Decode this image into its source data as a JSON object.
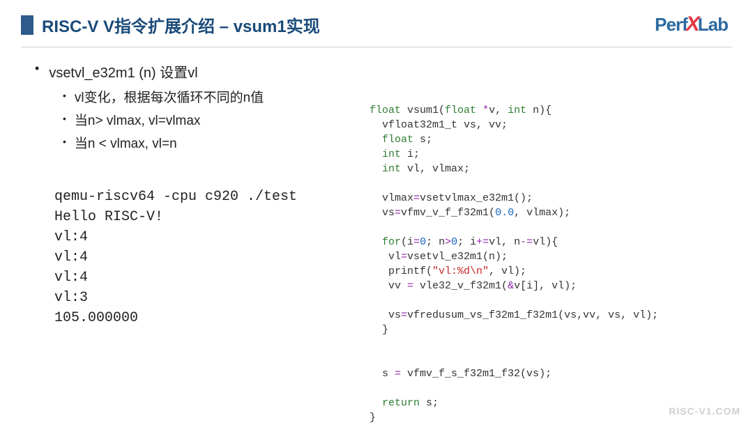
{
  "header": {
    "title": "RISC-V V指令扩展介绍 – vsum1实现"
  },
  "logo": {
    "part1": "Perf",
    "x": "X",
    "part2": "Lab"
  },
  "bullets": {
    "main": "vsetvl_e32m1 (n) 设置vl",
    "sub1": "vl变化，根据每次循环不同的n值",
    "sub2": "当n> vlmax, vl=vlmax",
    "sub3": "当n < vlmax, vl=n"
  },
  "terminal": {
    "line1": "qemu-riscv64 -cpu c920 ./test",
    "line2": "Hello RISC-V!",
    "line3": "vl:4",
    "line4": "vl:4",
    "line5": "vl:4",
    "line6": "vl:3",
    "line7": "105.000000"
  },
  "code": {
    "l1a": "float",
    "l1b": " vsum1(",
    "l1c": "float",
    "l1d": " ",
    "l1e": "*",
    "l1f": "v, ",
    "l1g": "int",
    "l1h": " n){",
    "l2": "  vfloat32m1_t vs, vv;",
    "l3a": "  ",
    "l3b": "float",
    "l3c": " s;",
    "l4a": "  ",
    "l4b": "int",
    "l4c": " i;",
    "l5a": "  ",
    "l5b": "int",
    "l5c": " vl, vlmax;",
    "l6": "",
    "l7a": "  vlmax",
    "l7b": "=",
    "l7c": "vsetvlmax_e32m1();",
    "l8a": "  vs",
    "l8b": "=",
    "l8c": "vfmv_v_f_f32m1(",
    "l8d": "0.0",
    "l8e": ", vlmax);",
    "l9": "",
    "l10a": "  ",
    "l10b": "for",
    "l10c": "(i",
    "l10d": "=",
    "l10e": "0",
    "l10f": "; n",
    "l10g": ">",
    "l10h": "0",
    "l10i": "; i",
    "l10j": "+=",
    "l10k": "vl, n",
    "l10l": "-=",
    "l10m": "vl){",
    "l11a": "   vl",
    "l11b": "=",
    "l11c": "vsetvl_e32m1(n);",
    "l12a": "   printf(",
    "l12b": "\"vl:%d\\n\"",
    "l12c": ", vl);",
    "l13a": "   vv ",
    "l13b": "=",
    "l13c": " vle32_v_f32m1(",
    "l13d": "&",
    "l13e": "v[i], vl);",
    "l14": "",
    "l15a": "   vs",
    "l15b": "=",
    "l15c": "vfredusum_vs_f32m1_f32m1(vs,vv, vs, vl);",
    "l16": "  }",
    "l17": "",
    "l18": "",
    "l19a": "  s ",
    "l19b": "=",
    "l19c": " vfmv_f_s_f32m1_f32(vs);",
    "l20": "",
    "l21a": "  ",
    "l21b": "return",
    "l21c": " s;",
    "l22": "}"
  },
  "watermark": "RISC-V1.COM"
}
